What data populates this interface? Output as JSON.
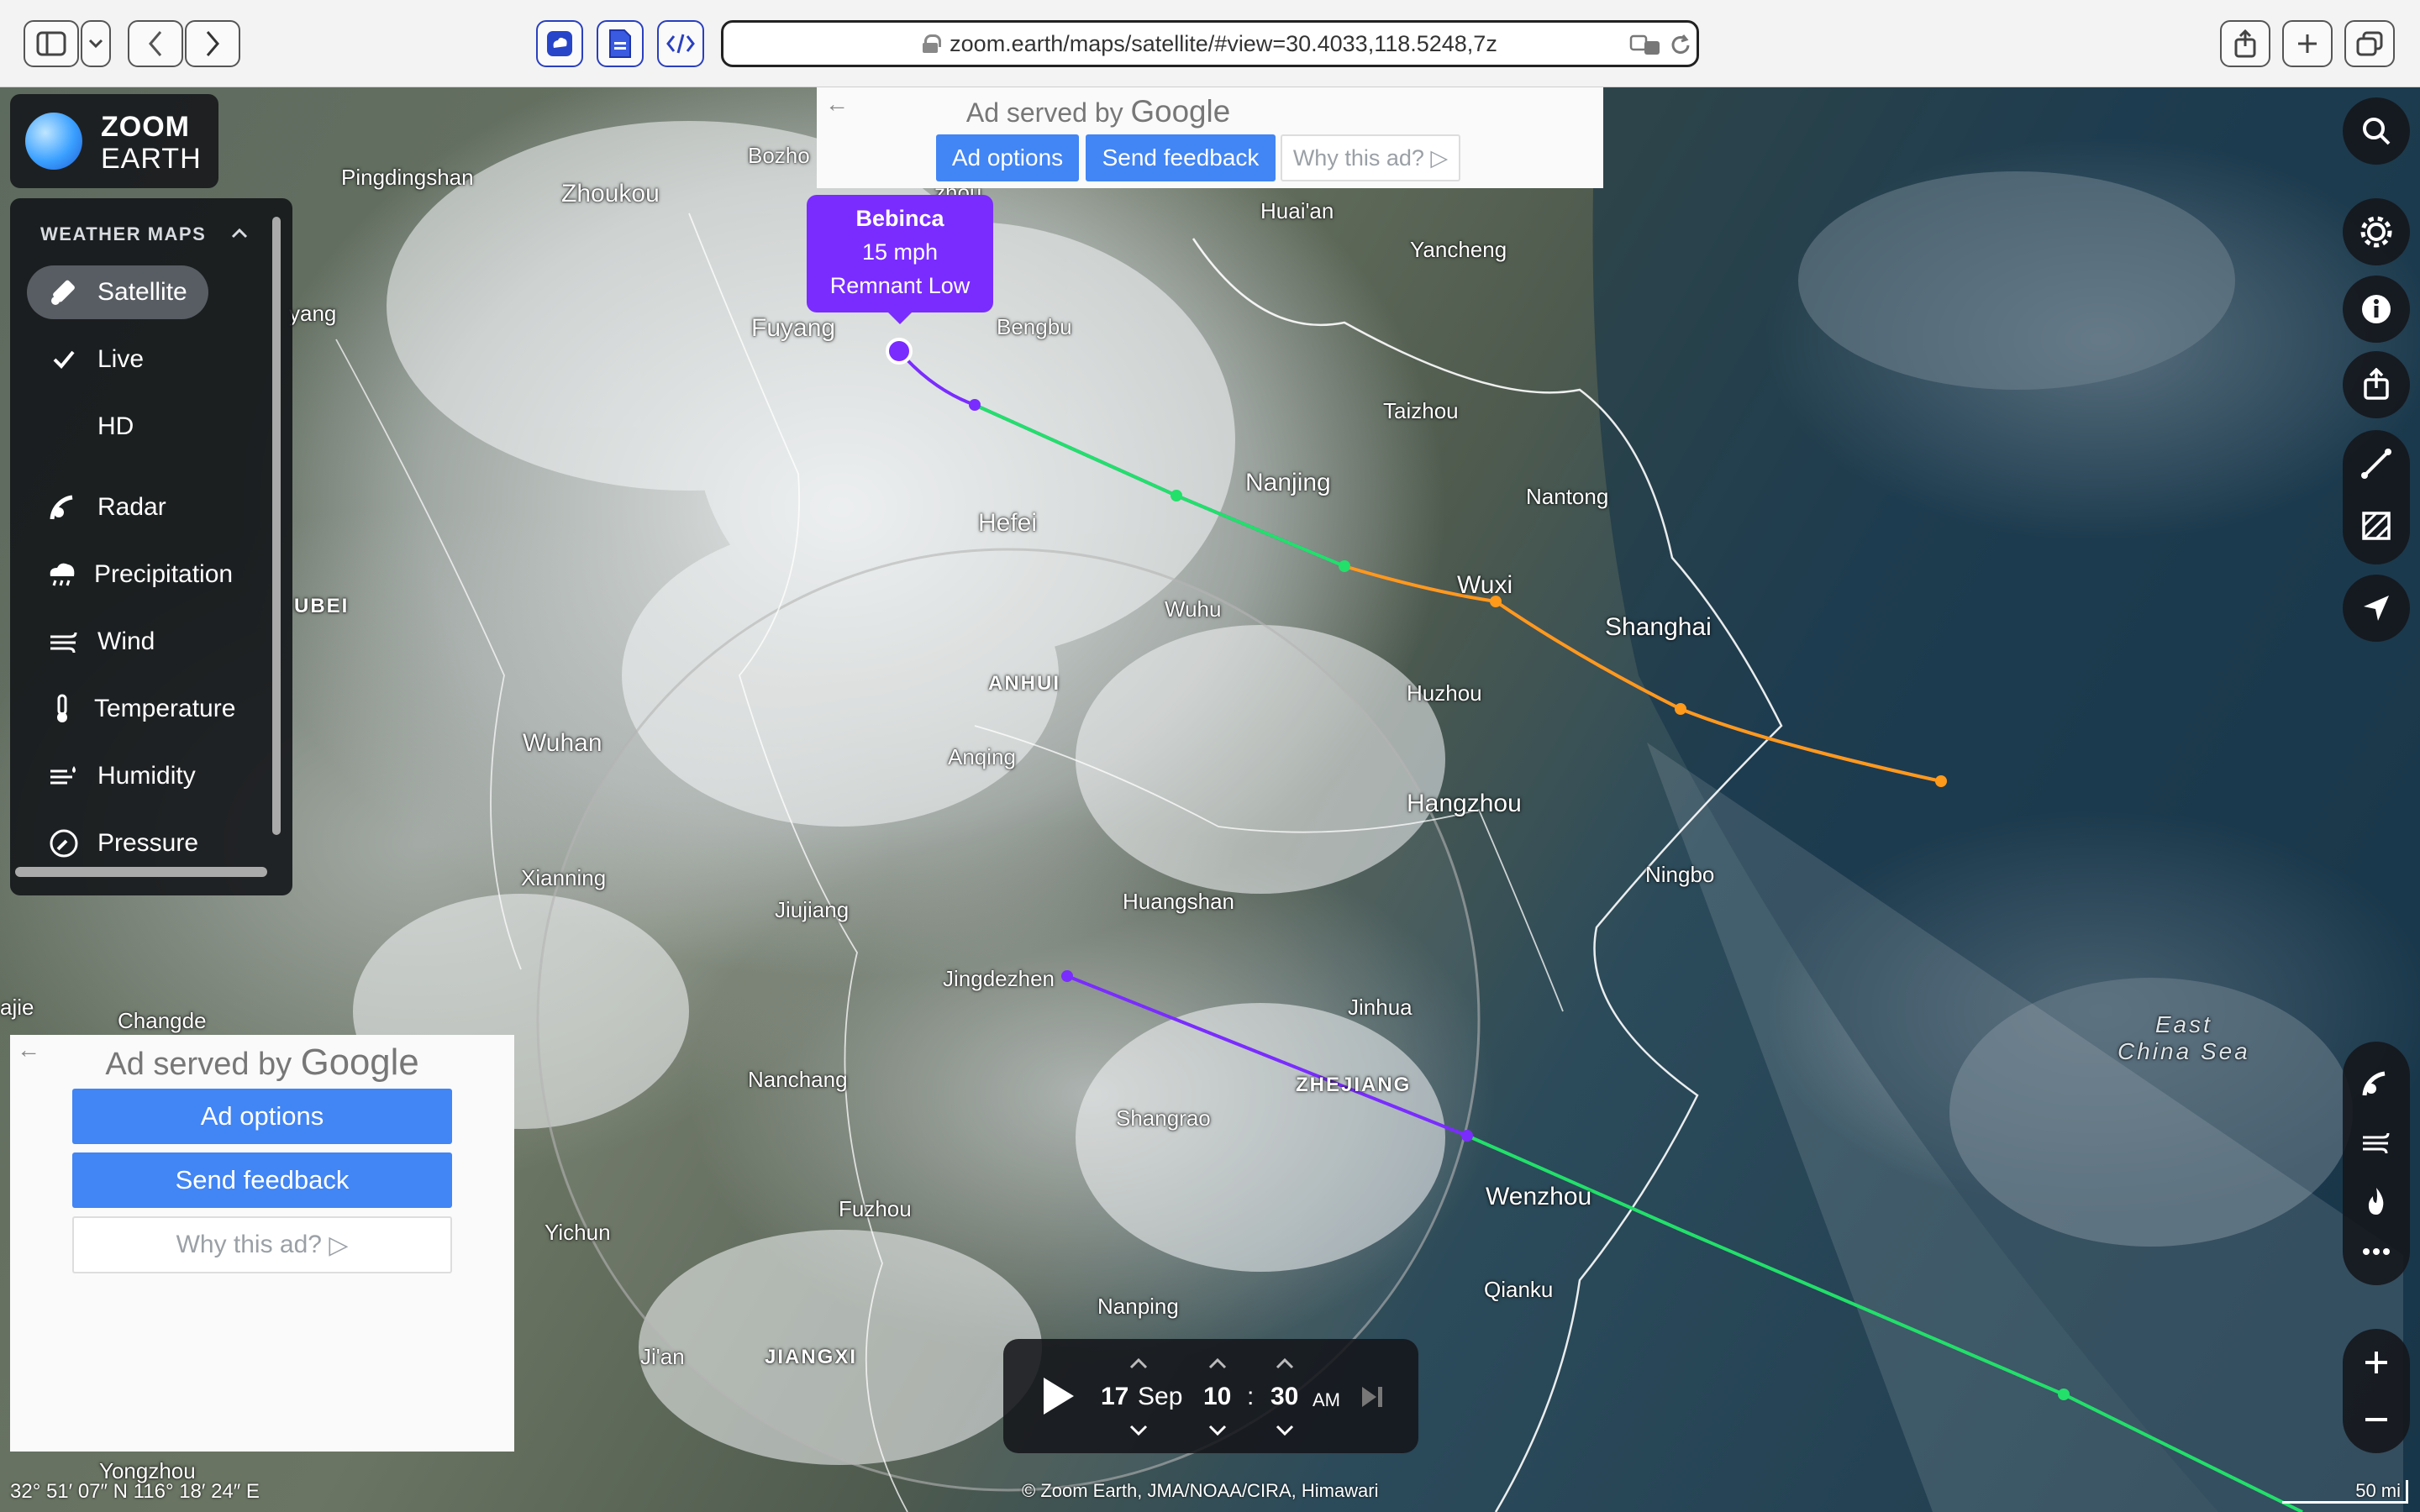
{
  "browser": {
    "url": "zoom.earth/maps/satellite/#view=30.4033,118.5248,7z"
  },
  "logo": {
    "line1": "ZOOM",
    "line2": "EARTH"
  },
  "panel": {
    "header": "WEATHER MAPS",
    "layers": [
      {
        "label": "Satellite",
        "icon": "satellite-icon",
        "active": true
      },
      {
        "label": "Live",
        "icon": "checkmark-icon"
      },
      {
        "label": "HD",
        "icon": ""
      },
      {
        "label": "Radar",
        "icon": "radar-icon"
      },
      {
        "label": "Precipitation",
        "icon": "precipitation-icon"
      },
      {
        "label": "Wind",
        "icon": "wind-icon"
      },
      {
        "label": "Temperature",
        "icon": "thermometer-icon"
      },
      {
        "label": "Humidity",
        "icon": "humidity-icon"
      },
      {
        "label": "Pressure",
        "icon": "pressure-icon"
      }
    ]
  },
  "ad_top": {
    "served_by": "Ad served by",
    "brand": "Google",
    "ad_options": "Ad options",
    "send_feedback": "Send feedback",
    "why": "Why this ad?"
  },
  "ad_bottom": {
    "served_by": "Ad served by",
    "brand": "Google",
    "ad_options": "Ad options",
    "send_feedback": "Send feedback",
    "why": "Why this ad?"
  },
  "storm": {
    "name": "Bebinca",
    "speed": "15 mph",
    "status": "Remnant Low"
  },
  "cities": [
    "Pingdingshan",
    "Zhoukou",
    "Bozho",
    "zhou",
    "Huai'an",
    "Yancheng",
    "yang",
    "Fuyang",
    "Bengbu",
    "Taizhou",
    "Nanjing",
    "Nantong",
    "Hefei",
    "Wuxi",
    "Shanghai",
    "UBEI",
    "Wuhu",
    "Huzhou",
    "ANHUI",
    "Wuhan",
    "Anqing",
    "Hangzhou",
    "Xianning",
    "Ningbo",
    "Jiujiang",
    "Huangshan",
    "Jingdezhen",
    "Changde",
    "ajie",
    "Jinhua",
    "Nanchang",
    "ZHEJIANG",
    "Shangrao",
    "Wenzhou",
    "Fuzhou",
    "Yichun",
    "Qianku",
    "Nanping",
    "Ji'an",
    "JIANGXI",
    "Yongzhou"
  ],
  "sea_label": [
    "East",
    "China Sea"
  ],
  "timeline": {
    "day": "17",
    "month": "Sep",
    "hour": "10",
    "sep": ":",
    "minute": "30",
    "ampm": "AM"
  },
  "coords": "32° 51′ 07″ N  116° 18′ 24″ E",
  "credit": "© Zoom Earth, JMA/NOAA/CIRA, Himawari",
  "scale": "50 mi",
  "colors": {
    "track_purple": "#7a2cff",
    "track_green": "#22e06a",
    "track_orange": "#ff9a1a",
    "ad_blue": "#4285f4"
  }
}
